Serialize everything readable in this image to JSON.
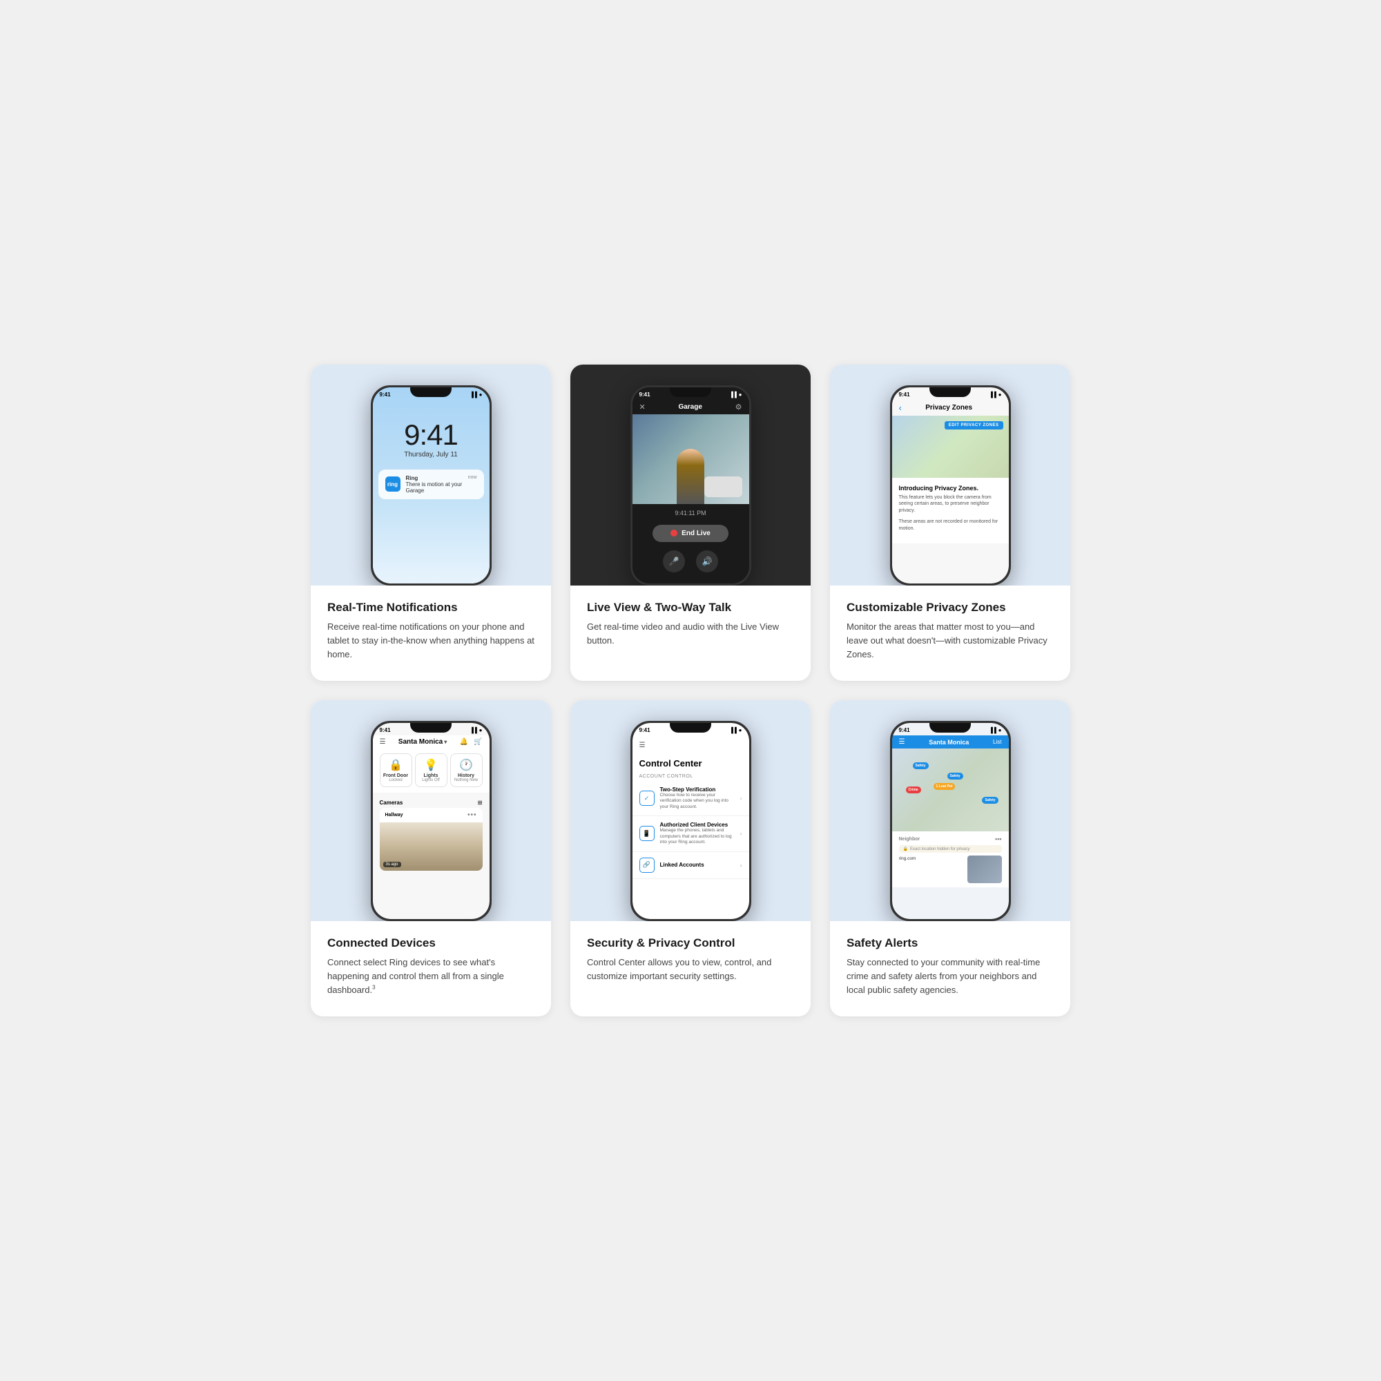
{
  "cards": [
    {
      "id": "card-notifications",
      "title": "Real-Time Notifications",
      "description": "Receive real-time notifications on your phone and tablet to stay in-the-know when anything happens at home.",
      "phone": {
        "time": "9:41",
        "date": "Thursday, July 11",
        "notification": {
          "app": "Ring",
          "message": "There is motion at your Garage",
          "time": "now"
        }
      }
    },
    {
      "id": "card-live-view",
      "title": "Live View & Two-Way Talk",
      "description": "Get real-time video and audio with the Live View button.",
      "phone": {
        "time": "9:41",
        "header": "Garage",
        "timestamp": "9:41:11 PM",
        "end_live_label": "End Live"
      }
    },
    {
      "id": "card-privacy-zones",
      "title": "Customizable Privacy Zones",
      "description": "Monitor the areas that matter most to you—and leave out what doesn't—with customizable Privacy Zones.",
      "phone": {
        "time": "9:41",
        "header": "Privacy Zones",
        "edit_btn": "EDIT PRIVACY ZONES",
        "intro_title": "Introducing Privacy Zones.",
        "intro_text1": "This feature lets you block the camera from seeing certain areas, to preserve neighbor privacy.",
        "intro_text2": "These areas are not recorded or monitored for motion."
      }
    },
    {
      "id": "card-connected-devices",
      "title": "Connected Devices",
      "description": "Connect select Ring devices to see what's happening and control them all from a single dashboard.",
      "footnote": "3",
      "phone": {
        "time": "9:41",
        "location": "Santa Monica",
        "shortcuts": [
          {
            "icon": "🔒",
            "name": "Front Door",
            "status": "Locked"
          },
          {
            "icon": "💡",
            "name": "Lights",
            "status": "Lights Off"
          },
          {
            "icon": "🕐",
            "name": "History",
            "status": "Nothing New"
          }
        ],
        "cameras_label": "Cameras",
        "hallway_label": "Hallway",
        "thumb_age": "3s ago"
      }
    },
    {
      "id": "card-security",
      "title": "Security & Privacy Control",
      "description": "Control Center allows you to view, control, and customize important security settings.",
      "phone": {
        "time": "9:41",
        "section_title": "Control Center",
        "account_label": "Account Control",
        "items": [
          {
            "name": "Two-Step Verification",
            "desc": "Choose how to receive your verification code when you log into your Ring account."
          },
          {
            "name": "Authorized Client Devices",
            "desc": "Manage the phones, tablets and computers that are authorized to log into your Ring account."
          },
          {
            "name": "Linked Accounts",
            "desc": ""
          }
        ]
      }
    },
    {
      "id": "card-safety-alerts",
      "title": "Safety Alerts",
      "description": "Stay connected to your community with real-time crime and safety alerts from your neighbors and local public safety agencies.",
      "phone": {
        "time": "9:41",
        "location": "Santa Monica",
        "list_label": "List",
        "map_pins": [
          {
            "label": "Safety",
            "type": "blue"
          },
          {
            "label": "Safety",
            "type": "blue"
          },
          {
            "label": "Crime",
            "type": "red"
          },
          {
            "label": "Safety",
            "type": "blue"
          },
          {
            "label": "1 Lost Pet",
            "type": "orange"
          }
        ],
        "neighbor_header": "Neighbor",
        "privacy_note": "Exact location hidden for privacy",
        "post_text": "ring.com"
      }
    }
  ]
}
